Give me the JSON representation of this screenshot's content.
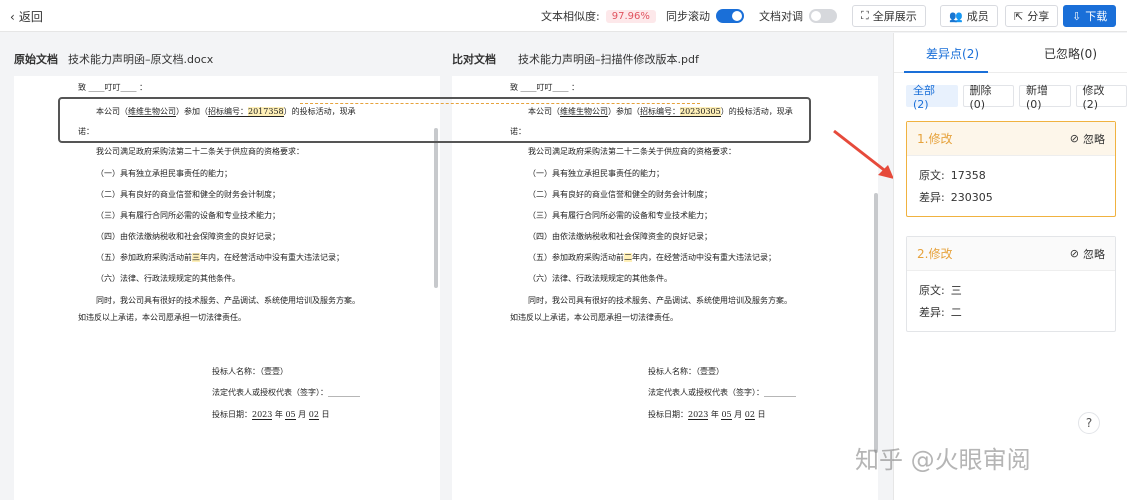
{
  "topbar": {
    "back_label": "返回",
    "similarity_label": "文本相似度:",
    "similarity_value": "97.96%",
    "sync_scroll_label": "同步滚动",
    "doc_align_label": "文档对调",
    "fullscreen_label": "全屏展示",
    "members_label": "成员",
    "share_label": "分享",
    "download_label": "下载"
  },
  "left_doc": {
    "label": "原始文档",
    "filename": "技术能力声明函–原文档.docx"
  },
  "right_doc": {
    "label": "比对文档",
    "filename": "技术能力声明函–扫描件修改版本.pdf"
  },
  "doc_text": {
    "to_line": "致 ____叮叮____ ：",
    "para1_a": "本公司（",
    "company": "维维生物公司",
    "para1_b": "）参加（",
    "bid_label": "招标编号：",
    "bid_left": "2017358",
    "bid_right": "20230305",
    "para1_c": "）的投标活动，现承",
    "para1_d": "诺：",
    "intro": "我公司满足政府采购法第二十二条关于供应商的资格要求：",
    "items": [
      "（一）具有独立承担民事责任的能力；",
      "（二）具有良好的商业信誉和健全的财务会计制度；",
      "（三）具有履行合同所必需的设备和专业技术能力；",
      "（四）由依法缴纳税收和社会保障资金的良好记录；"
    ],
    "item5_a": "（五）参加政府采购活动前",
    "item5_left": "三",
    "item5_right": "二",
    "item5_b": "年内，在经营活动中没有重大违法记录；",
    "item6": "（六）法律、行政法规规定的其他条件。",
    "para2": "同时，我公司具有很好的技术服务、产品调试、系统使用培训及服务方案。",
    "para3": "如违反以上承诺，本公司愿承担一切法律责任。",
    "sign_name": "投标人名称：（壹壹）",
    "sign_rep": "法定代表人或授权代表（签字）：________",
    "sign_date_label": "投标日期：",
    "sign_year": "2023",
    "sign_month": "05",
    "sign_day": "02"
  },
  "sidebar": {
    "tab_diff": "差异点",
    "tab_diff_count": "(2)",
    "tab_ignored": "已忽略(0)",
    "filters": [
      "全部(2)",
      "删除(0)",
      "新增(0)",
      "修改(2)"
    ],
    "cards": [
      {
        "title": "1.修改",
        "ignore": "忽略",
        "orig_label": "原文:",
        "orig": "17358",
        "diff_label": "差异:",
        "diff": "230305"
      },
      {
        "title": "2.修改",
        "ignore": "忽略",
        "orig_label": "原文:",
        "orig": "三",
        "diff_label": "差异:",
        "diff": "二"
      }
    ]
  },
  "help_label": "?",
  "watermark": "知乎 @火眼审阅",
  "colors": {
    "accent": "#1a6fd8",
    "warning": "#e6a23c",
    "danger": "#e0535f"
  }
}
